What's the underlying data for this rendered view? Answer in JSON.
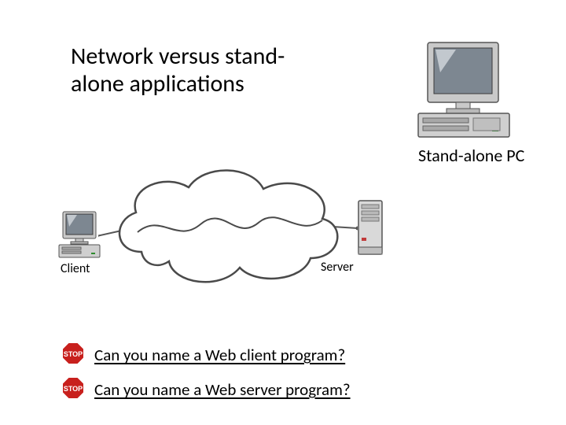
{
  "title": "Network versus stand-alone applications",
  "standalone_label": "Stand-alone PC",
  "diagram": {
    "client_label": "Client",
    "server_label": "Server"
  },
  "questions": {
    "q1": "Can you name a Web client program?",
    "q2": "Can you name a Web server program?"
  },
  "icons": {
    "stop_text": "STOP"
  }
}
